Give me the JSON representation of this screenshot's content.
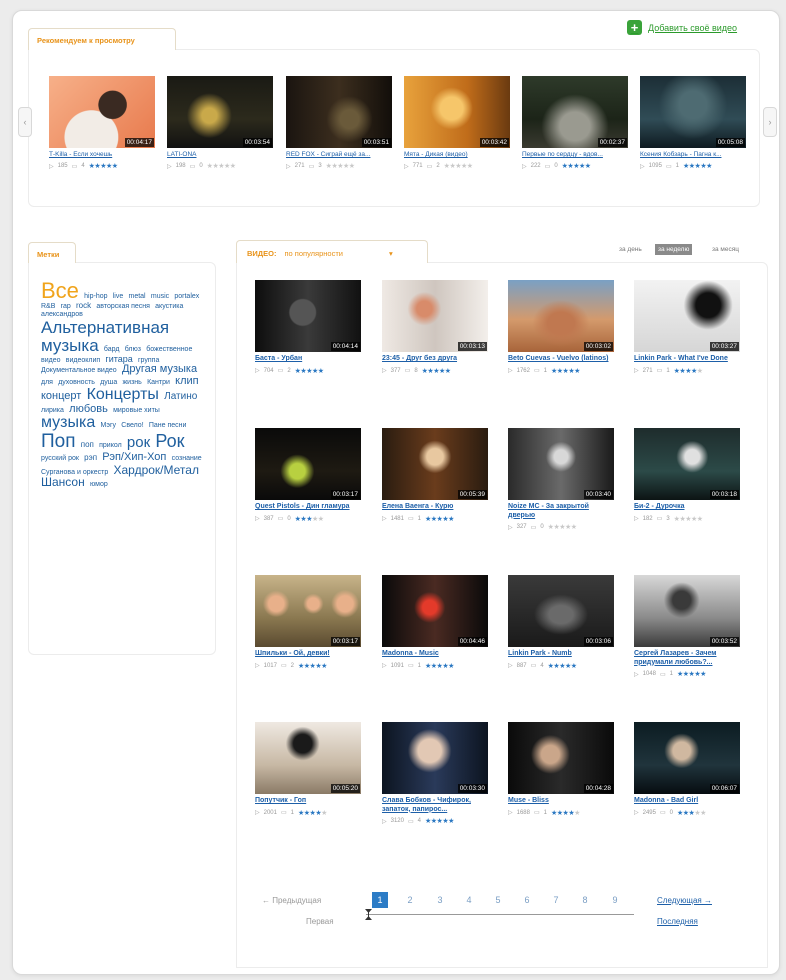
{
  "recommended": {
    "tab_label": "Рекомендуем к просмотру",
    "add_video": "Добавить своё видео",
    "items": [
      {
        "title": "Т-Killa - Если хочешь",
        "duration": "00:04:17",
        "views": "185",
        "comments": "4",
        "stars": 5
      },
      {
        "title": "LATI-ONA",
        "duration": "00:03:54",
        "views": "198",
        "comments": "0",
        "stars": 0
      },
      {
        "title": "RED FOX - Сиграй ещё за...",
        "duration": "00:03:51",
        "views": "271",
        "comments": "3",
        "stars": 0
      },
      {
        "title": "Мята - Дикая (видео)",
        "duration": "00:03:42",
        "views": "771",
        "comments": "2",
        "stars": 0
      },
      {
        "title": "Первые по сердцу - вдов...",
        "duration": "00:02:37",
        "views": "222",
        "comments": "0",
        "stars": 5
      },
      {
        "title": "Ксения Кобзарь - Пагна к...",
        "duration": "00:05:08",
        "views": "1095",
        "comments": "1",
        "stars": 5
      }
    ]
  },
  "tags": {
    "tab_label": "Метки",
    "items": [
      {
        "text": "Все",
        "size": 22,
        "color": "#f0a41c"
      },
      {
        "text": "hip-hop",
        "size": 7
      },
      {
        "text": "live",
        "size": 7
      },
      {
        "text": "metal",
        "size": 7
      },
      {
        "text": "music",
        "size": 7
      },
      {
        "text": "portalex",
        "size": 7
      },
      {
        "text": "R&B",
        "size": 7
      },
      {
        "text": "rap",
        "size": 7
      },
      {
        "text": "rock",
        "size": 8
      },
      {
        "text": "авторская песня",
        "size": 7
      },
      {
        "text": "акустика",
        "size": 7
      },
      {
        "text": "александров",
        "size": 7
      },
      {
        "text": "Альтернативная музыка",
        "size": 17
      },
      {
        "text": "бард",
        "size": 7
      },
      {
        "text": "блюз",
        "size": 7
      },
      {
        "text": "божественное видео",
        "size": 7
      },
      {
        "text": "видеоклип",
        "size": 7
      },
      {
        "text": "гитара",
        "size": 9
      },
      {
        "text": "группа",
        "size": 7
      },
      {
        "text": "Документальное видео",
        "size": 7
      },
      {
        "text": "Другая музыка",
        "size": 11
      },
      {
        "text": "для",
        "size": 7
      },
      {
        "text": "духовность",
        "size": 7
      },
      {
        "text": "душа",
        "size": 7
      },
      {
        "text": "жизнь",
        "size": 7
      },
      {
        "text": "Кантри",
        "size": 7
      },
      {
        "text": "клип",
        "size": 11
      },
      {
        "text": "концерт",
        "size": 11
      },
      {
        "text": "Концерты",
        "size": 16
      },
      {
        "text": "Латино",
        "size": 10
      },
      {
        "text": "лирика",
        "size": 7
      },
      {
        "text": "любовь",
        "size": 11
      },
      {
        "text": "мировые хиты",
        "size": 7
      },
      {
        "text": "музыка",
        "size": 16
      },
      {
        "text": "Мэгу",
        "size": 7
      },
      {
        "text": "Свело!",
        "size": 7
      },
      {
        "text": "Пане песни",
        "size": 7
      },
      {
        "text": "Поп",
        "size": 19
      },
      {
        "text": "поп",
        "size": 8
      },
      {
        "text": "прикол",
        "size": 7
      },
      {
        "text": "рок",
        "size": 15
      },
      {
        "text": "Рок",
        "size": 18
      },
      {
        "text": "русский рок",
        "size": 7
      },
      {
        "text": "рэп",
        "size": 8
      },
      {
        "text": "Рэп/Хип-Хоп",
        "size": 11
      },
      {
        "text": "сознание",
        "size": 7
      },
      {
        "text": "Сургановa и оркестр",
        "size": 7
      },
      {
        "text": "Хардрок/Метал",
        "size": 12
      },
      {
        "text": "Шансон",
        "size": 12
      },
      {
        "text": "юмор",
        "size": 7
      }
    ]
  },
  "videos": {
    "tab_label": "ВИДЕО:",
    "sort_value": "по популярности",
    "sort_arrow": "▾",
    "periods": [
      "за день",
      "за неделю",
      "за месяц"
    ],
    "active_period": "за неделю",
    "items": [
      {
        "title": "Баста - Урбан",
        "duration": "00:04:14",
        "views": "704",
        "comments": "2",
        "stars": 5
      },
      {
        "title": "23:45 - Друг без друга",
        "duration": "00:03:13",
        "views": "377",
        "comments": "8",
        "stars": 5
      },
      {
        "title": "Beto Cuevas - Vuelvo (latinos)",
        "duration": "00:03:02",
        "views": "1762",
        "comments": "1",
        "stars": 5
      },
      {
        "title": "Linkin Park - What I've Done",
        "duration": "00:03:27",
        "views": "271",
        "comments": "1",
        "stars": 4
      },
      {
        "title": "Quest Pistols - Дин гламура",
        "duration": "00:03:17",
        "views": "387",
        "comments": "0",
        "stars": 3
      },
      {
        "title": "Елена Ваенга - Курю",
        "duration": "00:05:39",
        "views": "1481",
        "comments": "1",
        "stars": 5
      },
      {
        "title": "Noize MC - За закрытой дверью",
        "duration": "00:03:40",
        "views": "327",
        "comments": "0",
        "stars": 0
      },
      {
        "title": "Би-2 - Дурочка",
        "duration": "00:03:18",
        "views": "182",
        "comments": "3",
        "stars": 0
      },
      {
        "title": "Шпильки - Ой, девки!",
        "duration": "00:03:17",
        "views": "1017",
        "comments": "2",
        "stars": 5
      },
      {
        "title": "Madonna - Music",
        "duration": "00:04:46",
        "views": "1091",
        "comments": "1",
        "stars": 5
      },
      {
        "title": "Linkin Park - Numb",
        "duration": "00:03:06",
        "views": "887",
        "comments": "4",
        "stars": 5
      },
      {
        "title": "Сергей Лазарев - Зачем придумали любовь?...",
        "duration": "00:03:52",
        "views": "1048",
        "comments": "1",
        "stars": 5
      },
      {
        "title": "Попутчик - Гоп",
        "duration": "00:05:20",
        "views": "2001",
        "comments": "1",
        "stars": 4
      },
      {
        "title": "Слава Бобков - Чифирок, запаток, папирос...",
        "duration": "00:03:30",
        "views": "3120",
        "comments": "4",
        "stars": 5
      },
      {
        "title": "Muse - Bliss",
        "duration": "00:04:28",
        "views": "1688",
        "comments": "1",
        "stars": 4
      },
      {
        "title": "Madonna - Bad Girl",
        "duration": "00:06:07",
        "views": "2495",
        "comments": "0",
        "stars": 3
      }
    ]
  },
  "pagination": {
    "prev": "← Предыдущая",
    "first": "Первая",
    "pages": [
      "1",
      "2",
      "3",
      "4",
      "5",
      "6",
      "7",
      "8",
      "9"
    ],
    "current": "1",
    "next": "Следующая →",
    "last": "Последняя"
  }
}
